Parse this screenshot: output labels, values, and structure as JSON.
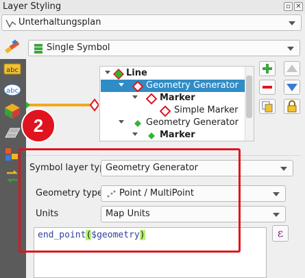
{
  "window": {
    "title": "Layer Styling"
  },
  "layer_combo": {
    "value": "Unterhaltungsplan",
    "icon": "line-layer-icon"
  },
  "renderer_combo": {
    "value": "Single Symbol",
    "icon": "single-symbol-icon"
  },
  "symbol_tree": {
    "rows": [
      {
        "label": "Line",
        "icon": "green-diamond-icon",
        "bold": true
      },
      {
        "label": "Geometry Generator",
        "icon": "red-diamond-icon",
        "selected": true
      },
      {
        "label": "Marker",
        "icon": "red-diamond-icon",
        "bold": true
      },
      {
        "label": "Simple Marker",
        "icon": "red-diamond-icon"
      },
      {
        "label": "Geometry Generator",
        "icon": "green-diamond-icon"
      },
      {
        "label": "Marker",
        "icon": "green-diamond-icon",
        "bold": true
      }
    ]
  },
  "badge": {
    "number": "2"
  },
  "properties": {
    "symbol_layer_type_label": "Symbol layer type",
    "symbol_layer_type_value": "Geometry Generator",
    "geometry_type_label": "Geometry type",
    "geometry_type_value": "Point / MultiPoint",
    "units_label": "Units",
    "units_value": "Map Units",
    "expression_fn": "end_point",
    "expression_open": "(",
    "expression_arg": "$geometry",
    "expression_close": ")",
    "expression_button": "ε"
  },
  "colors": {
    "accent": "#e0141e",
    "selection": "#308cc6",
    "preview_line": "#f0a91e"
  }
}
